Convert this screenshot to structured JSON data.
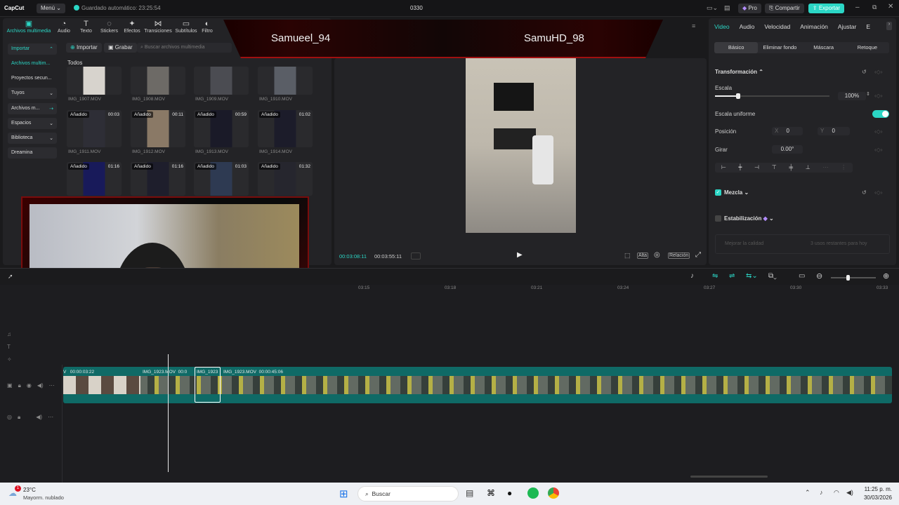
{
  "app": {
    "logo": "CapCut",
    "menu": "Menú",
    "autosave": "Guardado automático: 23:25:54",
    "project": "0330",
    "pro": "Pro",
    "share": "Compartir",
    "export": "Exportar"
  },
  "toolbar": [
    "Archivos multimedia",
    "Audio",
    "Texto",
    "Stickers",
    "Efectos",
    "Transiciones",
    "Subtítulos",
    "Filtro"
  ],
  "sidebar": [
    "Importar",
    "Archivos multim...",
    "Proyectos secun...",
    "Tuyos",
    "Archivos m...",
    "Espacios",
    "Biblioteca",
    "Dreamina"
  ],
  "media": {
    "import": "Importar",
    "record": "Grabar",
    "search_placeholder": "Buscar archivos multimedia",
    "all": "Todos",
    "added": "Añadido",
    "thumbs": [
      {
        "name": "IMG_1907.MOV",
        "dur": ""
      },
      {
        "name": "IMG_1908.MOV",
        "dur": ""
      },
      {
        "name": "IMG_1909.MOV",
        "dur": ""
      },
      {
        "name": "IMG_1910.MOV",
        "dur": ""
      },
      {
        "name": "IMG_1911.MOV",
        "dur": "00:03"
      },
      {
        "name": "IMG_1912.MOV",
        "dur": "00:11"
      },
      {
        "name": "IMG_1913.MOV",
        "dur": "00:59"
      },
      {
        "name": "IMG_1914.MOV",
        "dur": "01:02"
      },
      {
        "name": "",
        "dur": "01:16"
      },
      {
        "name": "",
        "dur": "01:16"
      },
      {
        "name": "",
        "dur": "01:03"
      },
      {
        "name": "",
        "dur": "01:32"
      }
    ]
  },
  "overlay": {
    "player1": "Samueel_94",
    "player2": "SamuHD_98"
  },
  "preview": {
    "current_time": "00:03:08:11",
    "total_time": "00:03:55:11",
    "ratio": "Relación",
    "quality": "Alta"
  },
  "props": {
    "tabs": [
      "Video",
      "Audio",
      "Velocidad",
      "Animación",
      "Ajustar",
      "E"
    ],
    "subtabs": [
      "Básico",
      "Eliminar fondo",
      "Máscara",
      "Retoque"
    ],
    "transform": "Transformación",
    "scale": "Escala",
    "scale_val": "100%",
    "scale_fraction": 0.1,
    "uniform": "Escala uniforme",
    "position": "Posición",
    "x_label": "X",
    "x_val": "0",
    "y_label": "Y",
    "y_val": "0",
    "rotate": "Girar",
    "rotate_val": "0.00°",
    "blend": "Mezcla",
    "stabilize": "Estabilización",
    "improve": "Mejorar la calidad",
    "pro_note": "3 usos restantes para hoy"
  },
  "timeline": {
    "ruler": [
      "03:15",
      "03:18",
      "03:21",
      "03:24",
      "03:27",
      "03:30",
      "03:33"
    ],
    "clips": [
      {
        "label": "V",
        "time": "00:00:03:22"
      },
      {
        "label": "IMG_1923.MOV",
        "time": "00:0"
      },
      {
        "label": "IMG_1923",
        "time": ""
      },
      {
        "label": "IMG_1923.MOV",
        "time": "00:00:45:06"
      }
    ]
  },
  "taskbar": {
    "temp": "23°C",
    "weather": "Mayorm. nublado",
    "search": "Buscar",
    "time": "11:25 p. m.",
    "date": "30/03/2026",
    "badge": "1"
  }
}
